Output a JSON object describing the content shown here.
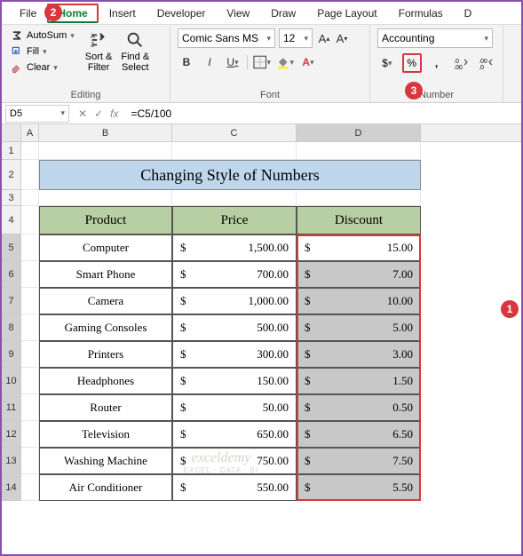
{
  "tabs": {
    "file": "File",
    "home": "Home",
    "insert": "Insert",
    "developer": "Developer",
    "view": "View",
    "draw": "Draw",
    "pagelayout": "Page Layout",
    "formulas": "Formulas",
    "d": "D"
  },
  "ribbon": {
    "editing": {
      "autosum": "AutoSum",
      "fill": "Fill",
      "clear": "Clear",
      "sort": "Sort &\nFilter",
      "find": "Find &\nSelect",
      "label": "Editing"
    },
    "font": {
      "name": "Comic Sans MS",
      "size": "12",
      "label": "Font"
    },
    "number": {
      "format": "Accounting",
      "label": "Number"
    }
  },
  "namebox": "D5",
  "formula": "=C5/100",
  "cols": {
    "A": "A",
    "B": "B",
    "C": "C",
    "D": "D"
  },
  "title": "Changing Style of Numbers",
  "headers": {
    "product": "Product",
    "price": "Price",
    "discount": "Discount"
  },
  "rows": [
    {
      "p": "Computer",
      "price": "1,500.00",
      "disc": "15.00"
    },
    {
      "p": "Smart Phone",
      "price": "700.00",
      "disc": "7.00"
    },
    {
      "p": "Camera",
      "price": "1,000.00",
      "disc": "10.00"
    },
    {
      "p": "Gaming Consoles",
      "price": "500.00",
      "disc": "5.00"
    },
    {
      "p": "Printers",
      "price": "300.00",
      "disc": "3.00"
    },
    {
      "p": "Headphones",
      "price": "150.00",
      "disc": "1.50"
    },
    {
      "p": "Router",
      "price": "50.00",
      "disc": "0.50"
    },
    {
      "p": "Television",
      "price": "650.00",
      "disc": "6.50"
    },
    {
      "p": "Washing Machine",
      "price": "750.00",
      "disc": "7.50"
    },
    {
      "p": "Air Conditioner",
      "price": "550.00",
      "disc": "5.50"
    }
  ],
  "currency": "$",
  "anno": {
    "a1": "1",
    "a2": "2",
    "a3": "3"
  },
  "watermark": {
    "l1": "exceldemy",
    "l2": "EXCEL · DATA · BI"
  }
}
